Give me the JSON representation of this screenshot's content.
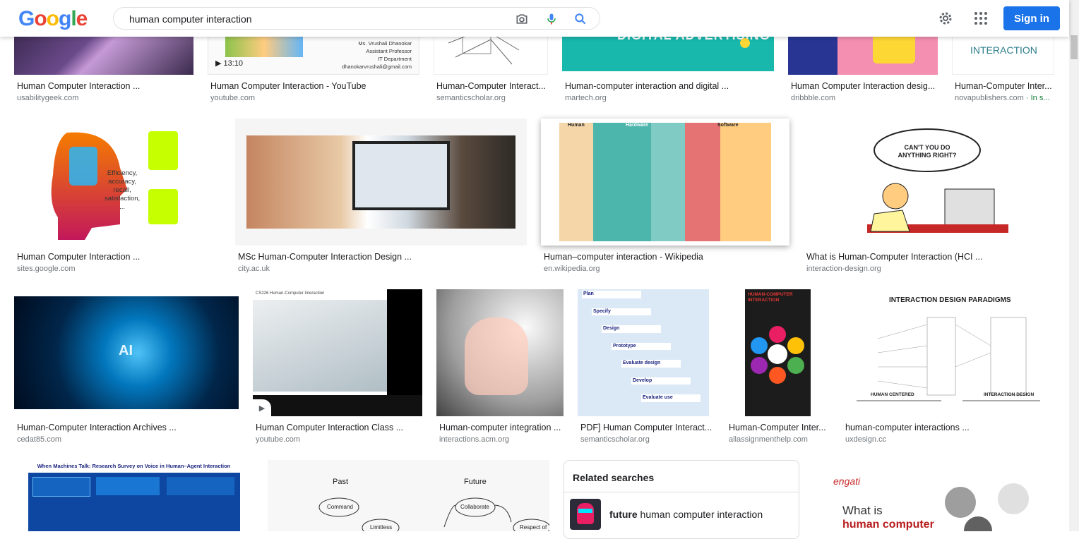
{
  "header": {
    "logo_letters": [
      "G",
      "o",
      "o",
      "g",
      "l",
      "e"
    ],
    "logo_colors": [
      "#4285F4",
      "#EA4335",
      "#FBBC05",
      "#4285F4",
      "#34A853",
      "#EA4335"
    ],
    "search_value": "human computer interaction",
    "signin_label": "Sign in",
    "icons": [
      "camera-icon",
      "microphone-icon",
      "search-icon",
      "gear-icon",
      "apps-grid-icon"
    ]
  },
  "results": [
    {
      "title": "Human Computer Interaction ...",
      "source": "usabilitygeek.com"
    },
    {
      "title": "Human Computer Interaction - YouTube",
      "source": "youtube.com",
      "duration": "13:10",
      "thumb_text": [
        "Ms. Vrushali Dhanokar",
        "Assistant Professor",
        "IT Department",
        "dhanokarvrushali@gmail.com"
      ]
    },
    {
      "title": "Human-Computer Interact...",
      "source": "semanticscholar.org"
    },
    {
      "title": "Human-computer interaction and digital ...",
      "source": "martech.org",
      "thumb_text": "DIGITAL ADVERTISING"
    },
    {
      "title": "Human Computer Interaction desig...",
      "source": "dribbble.com"
    },
    {
      "title": "Human-Computer Inter...",
      "source": "novapublishers.com",
      "source_extra": " · In s...",
      "thumb_text": "INTERACTION"
    },
    {
      "title": "Human Computer Interaction ...",
      "source": "sites.google.com",
      "thumb_text": [
        "Efficiency,",
        "accuracy,",
        "recall,",
        "satisfaction,",
        "..."
      ]
    },
    {
      "title": "MSc Human-Computer Interaction Design ...",
      "source": "city.ac.uk"
    },
    {
      "title": "Human–computer interaction - Wikipedia",
      "source": "en.wikipedia.org",
      "thumb_text": [
        "Human",
        "Hardware",
        "Software"
      ]
    },
    {
      "title": "What is Human-Computer Interaction (HCI ...",
      "source": "interaction-design.org",
      "thumb_text": [
        "CAN'T YOU DO",
        "ANYTHING RIGHT?"
      ]
    },
    {
      "title": "Human-Computer Interaction Archives ...",
      "source": "cedat85.com",
      "thumb_text": "AI"
    },
    {
      "title": "Human Computer Interaction Class ...",
      "source": "youtube.com",
      "thumb_text": "CS226 Human-Computer Interaction"
    },
    {
      "title": "Human-computer integration ...",
      "source": "interactions.acm.org"
    },
    {
      "title": "PDF] Human Computer Interact...",
      "source": "semanticscholar.org",
      "thumb_text": [
        "Plan",
        "Specify",
        "Design",
        "Prototype",
        "Evaluate design",
        "Develop",
        "Evaluate use"
      ]
    },
    {
      "title": "Human-Computer Inter...",
      "source": "allassignmenthelp.com",
      "thumb_text": [
        "HUMAN-COMPUTER",
        "INTERACTION"
      ]
    },
    {
      "title": "human-computer interactions ...",
      "source": "uxdesign.cc",
      "thumb_text": [
        "INTERACTION DESIGN PARADIGMS",
        "HUMAN CENTERED",
        "INTERACTION DESIGN"
      ]
    },
    {
      "thumb_text": "When Machines Talk: Research Survey on Voice in Human–Agent Interaction"
    },
    {
      "thumb_text": [
        "Past",
        "Future",
        "Command",
        "Collaborate",
        "Limitless",
        "Respect of"
      ]
    },
    {
      "thumb_text": [
        "What is",
        "human computer"
      ]
    }
  ],
  "related": {
    "heading": "Related searches",
    "item_bold": "future",
    "item_rest": " human computer interaction"
  },
  "colors": {
    "accent": "#1a73e8",
    "source_grey": "#70757a",
    "green": "#188038"
  }
}
